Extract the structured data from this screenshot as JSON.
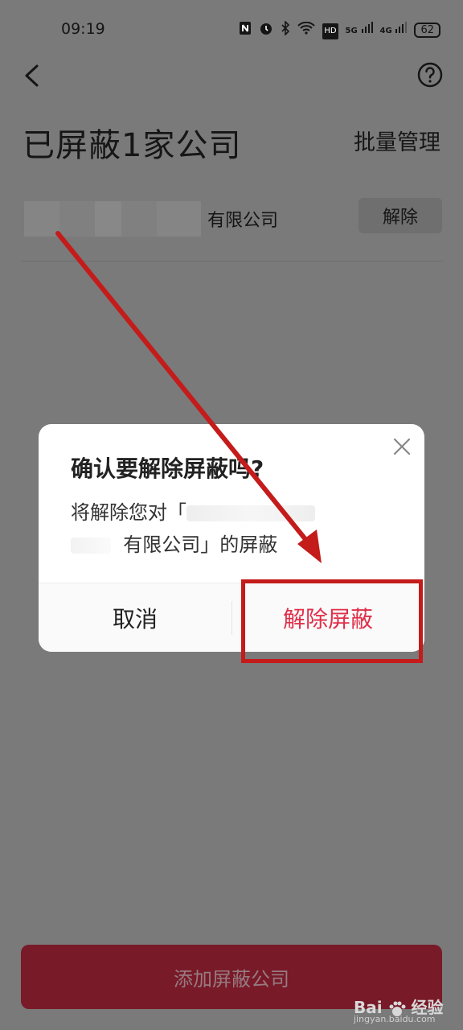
{
  "status_bar": {
    "time": "09:19",
    "icons": [
      "nfc-icon",
      "alarm-icon",
      "bluetooth-icon",
      "wifi-icon",
      "hd-icon",
      "5g-signal-icon",
      "4g-signal-icon"
    ],
    "network_1": "5G",
    "network_2": "4G",
    "hd": "HD",
    "battery": "62"
  },
  "header": {
    "title": "已屏蔽1家公司",
    "batch_manage": "批量管理"
  },
  "company_list": [
    {
      "name_visible": "有限公司",
      "action": "解除"
    }
  ],
  "dialog": {
    "title": "确认要解除屏蔽吗?",
    "message_prefix": "将解除您对「",
    "message_suffix": "有限公司」的屏蔽",
    "cancel": "取消",
    "confirm": "解除屏蔽"
  },
  "bottom": {
    "add_button": "添加屏蔽公司"
  },
  "watermark": {
    "brand": "Bai",
    "brand_cn": "经验",
    "url": "jingyan.baidu.com"
  },
  "colors": {
    "accent": "#e0304a",
    "overlay": "#7a7a7a",
    "annotation": "#c41b1b"
  }
}
